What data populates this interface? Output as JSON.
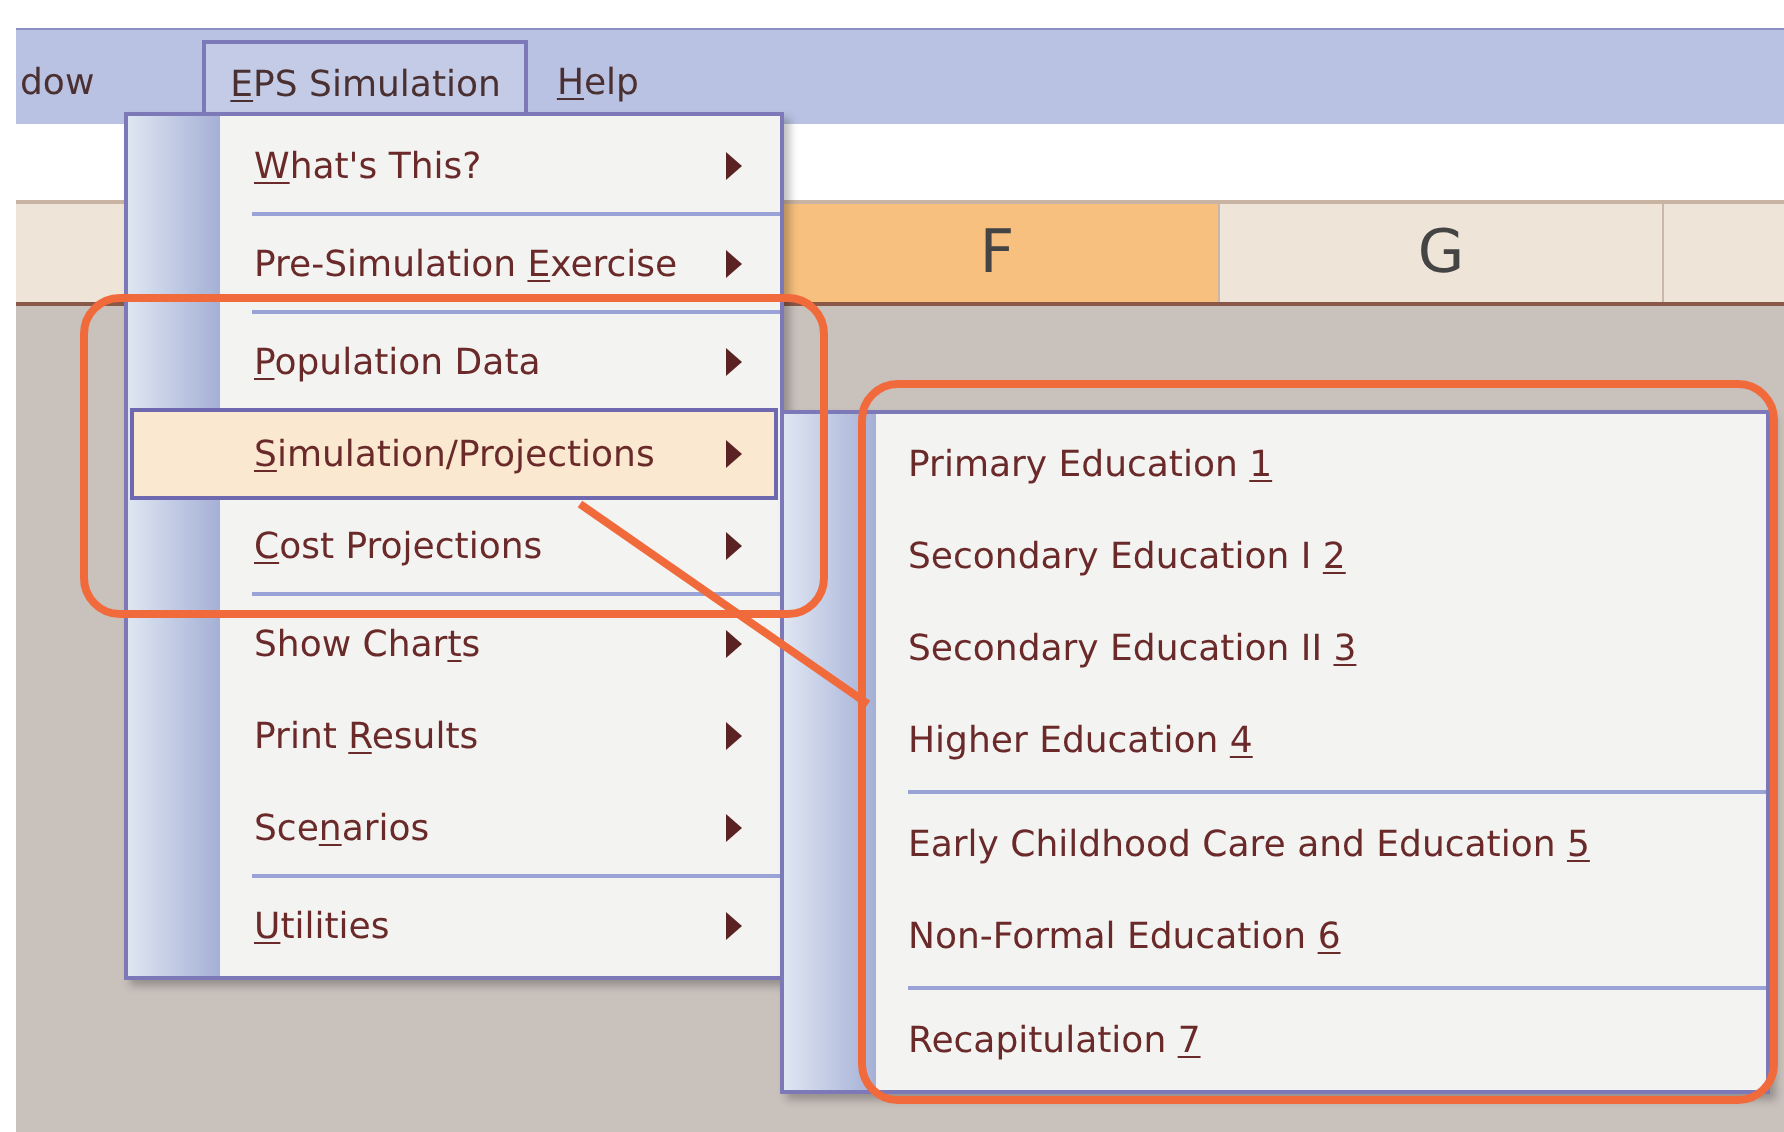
{
  "menubar": [
    {
      "label": "dow",
      "selected": false
    },
    {
      "access_key": "E",
      "suffix": "PS Simulation",
      "selected": true
    },
    {
      "access_key": "H",
      "suffix": "elp",
      "selected": false
    }
  ],
  "columns": [
    {
      "label": "F",
      "selected": true
    },
    {
      "label": "G",
      "selected": false
    }
  ],
  "menu": {
    "items": [
      {
        "kind": "item",
        "access_key": "W",
        "suffix": "hat's This?",
        "selected": false
      },
      {
        "kind": "separator"
      },
      {
        "kind": "item",
        "prefix": "Pre-Simulation ",
        "access_key": "E",
        "suffix": "xercise",
        "selected": false
      },
      {
        "kind": "separator"
      },
      {
        "kind": "item",
        "access_key": "P",
        "suffix": "opulation Data",
        "selected": false
      },
      {
        "kind": "item",
        "access_key": "S",
        "suffix": "imulation/Projections",
        "selected": true
      },
      {
        "kind": "item",
        "access_key": "C",
        "suffix": "ost Projections",
        "selected": false
      },
      {
        "kind": "separator"
      },
      {
        "kind": "item",
        "prefix": "Show Char",
        "access_key": "t",
        "suffix": "s",
        "selected": false
      },
      {
        "kind": "item",
        "prefix": "Print ",
        "access_key": "R",
        "suffix": "esults",
        "selected": false
      },
      {
        "kind": "item",
        "prefix": "Sce",
        "access_key": "n",
        "suffix": "arios",
        "selected": false
      },
      {
        "kind": "separator"
      },
      {
        "kind": "item",
        "access_key": "U",
        "suffix": "tilities",
        "selected": false
      }
    ]
  },
  "submenu": {
    "items": [
      {
        "kind": "item",
        "prefix": "Primary Education ",
        "access_key": "1"
      },
      {
        "kind": "item",
        "prefix": "Secondary Education I ",
        "access_key": "2"
      },
      {
        "kind": "item",
        "prefix": "Secondary Education II ",
        "access_key": "3"
      },
      {
        "kind": "item",
        "prefix": "Higher Education ",
        "access_key": "4"
      },
      {
        "kind": "separator"
      },
      {
        "kind": "item",
        "prefix": "Early Childhood Care and Education ",
        "access_key": "5"
      },
      {
        "kind": "item",
        "prefix": "Non-Formal Education ",
        "access_key": "6"
      },
      {
        "kind": "separator"
      },
      {
        "kind": "item",
        "prefix": "Recapitulation ",
        "access_key": "7"
      }
    ]
  }
}
